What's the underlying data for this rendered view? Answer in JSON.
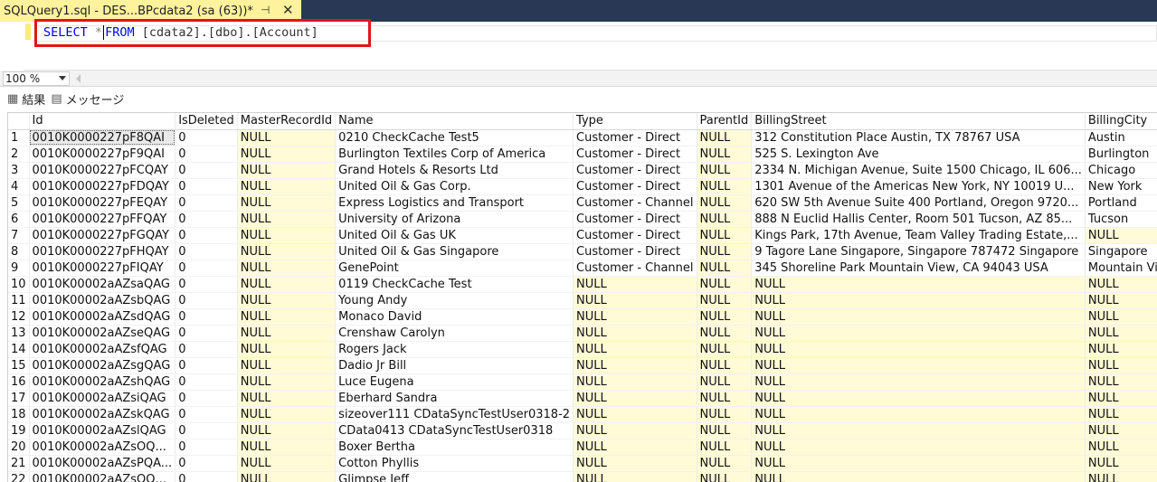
{
  "tab": {
    "title": "SQLQuery1.sql - DES...BPcdata2 (sa (63))*",
    "pin_icon": "pin-icon",
    "close_icon": "close-icon"
  },
  "editor": {
    "query": {
      "select": "SELECT",
      "star": "*",
      "from": "FROM",
      "rest": "[cdata2].[dbo].[Account]"
    },
    "highlight_color": "#e0151b",
    "keyword_color": "#0000ff"
  },
  "zoom": {
    "value": "100 %"
  },
  "result_tabs": [
    {
      "label": "結果",
      "icon": "grid-icon"
    },
    {
      "label": "メッセージ",
      "icon": "message-icon"
    }
  ],
  "grid": {
    "columns": [
      "",
      "Id",
      "IsDeleted",
      "MasterRecordId",
      "Name",
      "Type",
      "ParentId",
      "BillingStreet",
      "BillingCity"
    ],
    "null_color": "#fffbd7",
    "rows": [
      [
        "1",
        "0010K0000227pF8QAI",
        "0",
        "NULL",
        "0210 CheckCache Test5",
        "Customer - Direct",
        "NULL",
        "312 Constitution Place Austin, TX 78767 USA",
        "Austin"
      ],
      [
        "2",
        "0010K0000227pF9QAI",
        "0",
        "NULL",
        "Burlington Textiles Corp of America",
        "Customer - Direct",
        "NULL",
        "525 S. Lexington Ave",
        "Burlington"
      ],
      [
        "3",
        "0010K0000227pFCQAY",
        "0",
        "NULL",
        "Grand Hotels & Resorts Ltd",
        "Customer - Direct",
        "NULL",
        "2334 N. Michigan Avenue, Suite 1500 Chicago, IL 606...",
        "Chicago"
      ],
      [
        "4",
        "0010K0000227pFDQAY",
        "0",
        "NULL",
        "United Oil & Gas Corp.",
        "Customer - Direct",
        "NULL",
        "1301 Avenue of the Americas  New York, NY 10019 U...",
        "New York"
      ],
      [
        "5",
        "0010K0000227pFEQAY",
        "0",
        "NULL",
        "Express Logistics and Transport",
        "Customer - Channel",
        "NULL",
        "620 SW 5th Avenue Suite 400 Portland, Oregon 9720...",
        "Portland"
      ],
      [
        "6",
        "0010K0000227pFFQAY",
        "0",
        "NULL",
        "University of Arizona",
        "Customer - Direct",
        "NULL",
        "888 N Euclid  Hallis Center, Room 501 Tucson, AZ 85...",
        "Tucson"
      ],
      [
        "7",
        "0010K0000227pFGQAY",
        "0",
        "NULL",
        "United Oil & Gas UK",
        "Customer - Direct",
        "NULL",
        "Kings Park, 17th Avenue, Team Valley Trading Estate,...",
        "NULL"
      ],
      [
        "8",
        "0010K0000227pFHQAY",
        "0",
        "NULL",
        "United Oil & Gas Singapore",
        "Customer - Direct",
        "NULL",
        "9 Tagore Lane Singapore, Singapore 787472 Singapore",
        "Singapore"
      ],
      [
        "9",
        "0010K0000227pFIQAY",
        "0",
        "NULL",
        "GenePoint",
        "Customer - Channel",
        "NULL",
        "345 Shoreline Park Mountain View, CA 94043 USA",
        "Mountain View"
      ],
      [
        "10",
        "0010K00002aAZsaQAG",
        "0",
        "NULL",
        "0119 CheckCache Test",
        "NULL",
        "NULL",
        "NULL",
        "NULL"
      ],
      [
        "11",
        "0010K00002aAZsbQAG",
        "0",
        "NULL",
        "Young Andy",
        "NULL",
        "NULL",
        "NULL",
        "NULL"
      ],
      [
        "12",
        "0010K00002aAZsdQAG",
        "0",
        "NULL",
        "Monaco David",
        "NULL",
        "NULL",
        "NULL",
        "NULL"
      ],
      [
        "13",
        "0010K00002aAZseQAG",
        "0",
        "NULL",
        "Crenshaw Carolyn",
        "NULL",
        "NULL",
        "NULL",
        "NULL"
      ],
      [
        "14",
        "0010K00002aAZsfQAG",
        "0",
        "NULL",
        "Rogers Jack",
        "NULL",
        "NULL",
        "NULL",
        "NULL"
      ],
      [
        "15",
        "0010K00002aAZsgQAG",
        "0",
        "NULL",
        "Dadio Jr Bill",
        "NULL",
        "NULL",
        "NULL",
        "NULL"
      ],
      [
        "16",
        "0010K00002aAZshQAG",
        "0",
        "NULL",
        "Luce Eugena",
        "NULL",
        "NULL",
        "NULL",
        "NULL"
      ],
      [
        "17",
        "0010K00002aAZsiQAG",
        "0",
        "NULL",
        "Eberhard Sandra",
        "NULL",
        "NULL",
        "NULL",
        "NULL"
      ],
      [
        "18",
        "0010K00002aAZskQAG",
        "0",
        "NULL",
        "sizeover111 CDataSyncTestUser0318-2",
        "NULL",
        "NULL",
        "NULL",
        "NULL"
      ],
      [
        "19",
        "0010K00002aAZslQAG",
        "0",
        "NULL",
        "CData0413 CDataSyncTestUser0318",
        "NULL",
        "NULL",
        "NULL",
        "NULL"
      ],
      [
        "20",
        "0010K00002aAZsOQ...",
        "0",
        "NULL",
        "Boxer Bertha",
        "NULL",
        "NULL",
        "NULL",
        "NULL"
      ],
      [
        "21",
        "0010K00002aAZsPQA...",
        "0",
        "NULL",
        "Cotton Phyllis",
        "NULL",
        "NULL",
        "NULL",
        "NULL"
      ],
      [
        "22",
        "0010K00002aAZsQQ...",
        "0",
        "NULL",
        "Glimpse Jeff",
        "NULL",
        "NULL",
        "NULL",
        "NULL"
      ]
    ]
  }
}
